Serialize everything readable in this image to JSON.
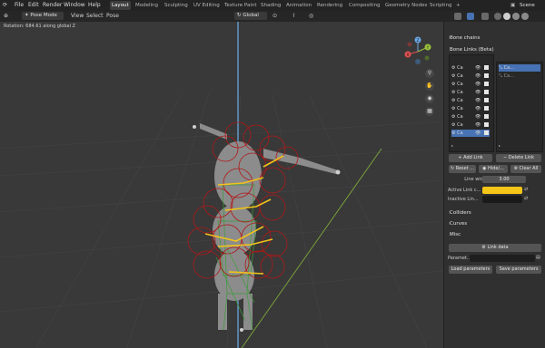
{
  "topbar": {
    "menus": [
      "File",
      "Edit",
      "Render",
      "Window",
      "Help"
    ],
    "workspaces": [
      "Layout",
      "Modeling",
      "Sculpting",
      "UV Editing",
      "Texture Paint",
      "Shading",
      "Animation",
      "Rendering",
      "Compositing",
      "Geometry Nodes",
      "Scripting"
    ],
    "active_workspace": "Layout",
    "scene_label": "Scene"
  },
  "viewport_header": {
    "mode": "Pose Mode",
    "menus": [
      "View",
      "Select",
      "Pose"
    ],
    "orientation": "Global"
  },
  "status": {
    "text": "Rotation: 684.61 along global Z"
  },
  "gizmo": {
    "z": "Z",
    "y": "Y",
    "x": "X"
  },
  "sidebar": {
    "bone_chains": "Bone chains",
    "bone_links": "Bone Links (Beta)",
    "list_left_label": "Ca",
    "list_right_label": "Ca...",
    "add_link": "Add Link",
    "delete_link": "Delete Link",
    "reset": "Reset ...",
    "hide": "Hide/...",
    "clear_all": "Clear All",
    "line_width_label": "Line width",
    "line_width_value": "3.00",
    "active_link_label": "Active Link c...",
    "inactive_link_label": "Inactive Lin...",
    "colliders": "Colliders",
    "curves": "Curves",
    "misc": "Misc",
    "link_data": "Link data",
    "param_label": "Paramet...",
    "load_params": "Load parameters",
    "save_params": "Save parameters"
  },
  "colors": {
    "accent": "#4772b3",
    "active_link_color": "#f5c518",
    "inactive_link_color": "#1a1a1a",
    "collider_red": "#b01818",
    "bone_green": "#3a9d3a",
    "link_yellow": "#f2c31a"
  }
}
